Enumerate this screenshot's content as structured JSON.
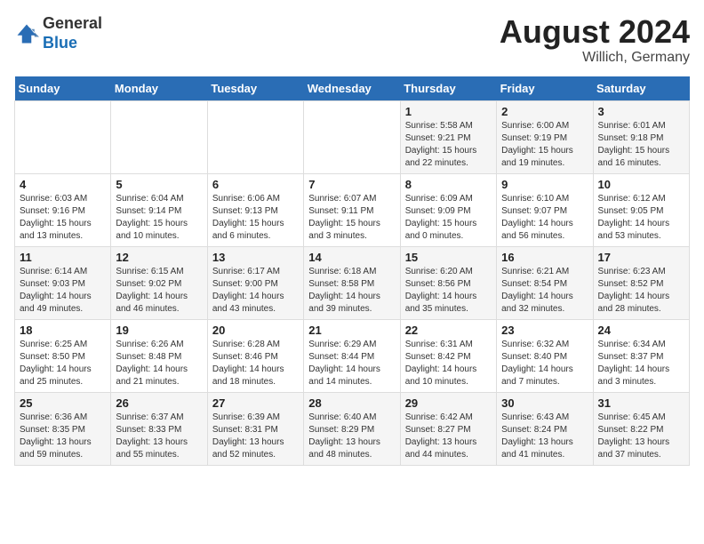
{
  "logo": {
    "general": "General",
    "blue": "Blue"
  },
  "title": {
    "month_year": "August 2024",
    "location": "Willich, Germany"
  },
  "headers": [
    "Sunday",
    "Monday",
    "Tuesday",
    "Wednesday",
    "Thursday",
    "Friday",
    "Saturday"
  ],
  "weeks": [
    [
      {
        "day": "",
        "info": ""
      },
      {
        "day": "",
        "info": ""
      },
      {
        "day": "",
        "info": ""
      },
      {
        "day": "",
        "info": ""
      },
      {
        "day": "1",
        "info": "Sunrise: 5:58 AM\nSunset: 9:21 PM\nDaylight: 15 hours and 22 minutes."
      },
      {
        "day": "2",
        "info": "Sunrise: 6:00 AM\nSunset: 9:19 PM\nDaylight: 15 hours and 19 minutes."
      },
      {
        "day": "3",
        "info": "Sunrise: 6:01 AM\nSunset: 9:18 PM\nDaylight: 15 hours and 16 minutes."
      }
    ],
    [
      {
        "day": "4",
        "info": "Sunrise: 6:03 AM\nSunset: 9:16 PM\nDaylight: 15 hours and 13 minutes."
      },
      {
        "day": "5",
        "info": "Sunrise: 6:04 AM\nSunset: 9:14 PM\nDaylight: 15 hours and 10 minutes."
      },
      {
        "day": "6",
        "info": "Sunrise: 6:06 AM\nSunset: 9:13 PM\nDaylight: 15 hours and 6 minutes."
      },
      {
        "day": "7",
        "info": "Sunrise: 6:07 AM\nSunset: 9:11 PM\nDaylight: 15 hours and 3 minutes."
      },
      {
        "day": "8",
        "info": "Sunrise: 6:09 AM\nSunset: 9:09 PM\nDaylight: 15 hours and 0 minutes."
      },
      {
        "day": "9",
        "info": "Sunrise: 6:10 AM\nSunset: 9:07 PM\nDaylight: 14 hours and 56 minutes."
      },
      {
        "day": "10",
        "info": "Sunrise: 6:12 AM\nSunset: 9:05 PM\nDaylight: 14 hours and 53 minutes."
      }
    ],
    [
      {
        "day": "11",
        "info": "Sunrise: 6:14 AM\nSunset: 9:03 PM\nDaylight: 14 hours and 49 minutes."
      },
      {
        "day": "12",
        "info": "Sunrise: 6:15 AM\nSunset: 9:02 PM\nDaylight: 14 hours and 46 minutes."
      },
      {
        "day": "13",
        "info": "Sunrise: 6:17 AM\nSunset: 9:00 PM\nDaylight: 14 hours and 43 minutes."
      },
      {
        "day": "14",
        "info": "Sunrise: 6:18 AM\nSunset: 8:58 PM\nDaylight: 14 hours and 39 minutes."
      },
      {
        "day": "15",
        "info": "Sunrise: 6:20 AM\nSunset: 8:56 PM\nDaylight: 14 hours and 35 minutes."
      },
      {
        "day": "16",
        "info": "Sunrise: 6:21 AM\nSunset: 8:54 PM\nDaylight: 14 hours and 32 minutes."
      },
      {
        "day": "17",
        "info": "Sunrise: 6:23 AM\nSunset: 8:52 PM\nDaylight: 14 hours and 28 minutes."
      }
    ],
    [
      {
        "day": "18",
        "info": "Sunrise: 6:25 AM\nSunset: 8:50 PM\nDaylight: 14 hours and 25 minutes."
      },
      {
        "day": "19",
        "info": "Sunrise: 6:26 AM\nSunset: 8:48 PM\nDaylight: 14 hours and 21 minutes."
      },
      {
        "day": "20",
        "info": "Sunrise: 6:28 AM\nSunset: 8:46 PM\nDaylight: 14 hours and 18 minutes."
      },
      {
        "day": "21",
        "info": "Sunrise: 6:29 AM\nSunset: 8:44 PM\nDaylight: 14 hours and 14 minutes."
      },
      {
        "day": "22",
        "info": "Sunrise: 6:31 AM\nSunset: 8:42 PM\nDaylight: 14 hours and 10 minutes."
      },
      {
        "day": "23",
        "info": "Sunrise: 6:32 AM\nSunset: 8:40 PM\nDaylight: 14 hours and 7 minutes."
      },
      {
        "day": "24",
        "info": "Sunrise: 6:34 AM\nSunset: 8:37 PM\nDaylight: 14 hours and 3 minutes."
      }
    ],
    [
      {
        "day": "25",
        "info": "Sunrise: 6:36 AM\nSunset: 8:35 PM\nDaylight: 13 hours and 59 minutes."
      },
      {
        "day": "26",
        "info": "Sunrise: 6:37 AM\nSunset: 8:33 PM\nDaylight: 13 hours and 55 minutes."
      },
      {
        "day": "27",
        "info": "Sunrise: 6:39 AM\nSunset: 8:31 PM\nDaylight: 13 hours and 52 minutes."
      },
      {
        "day": "28",
        "info": "Sunrise: 6:40 AM\nSunset: 8:29 PM\nDaylight: 13 hours and 48 minutes."
      },
      {
        "day": "29",
        "info": "Sunrise: 6:42 AM\nSunset: 8:27 PM\nDaylight: 13 hours and 44 minutes."
      },
      {
        "day": "30",
        "info": "Sunrise: 6:43 AM\nSunset: 8:24 PM\nDaylight: 13 hours and 41 minutes."
      },
      {
        "day": "31",
        "info": "Sunrise: 6:45 AM\nSunset: 8:22 PM\nDaylight: 13 hours and 37 minutes."
      }
    ]
  ]
}
